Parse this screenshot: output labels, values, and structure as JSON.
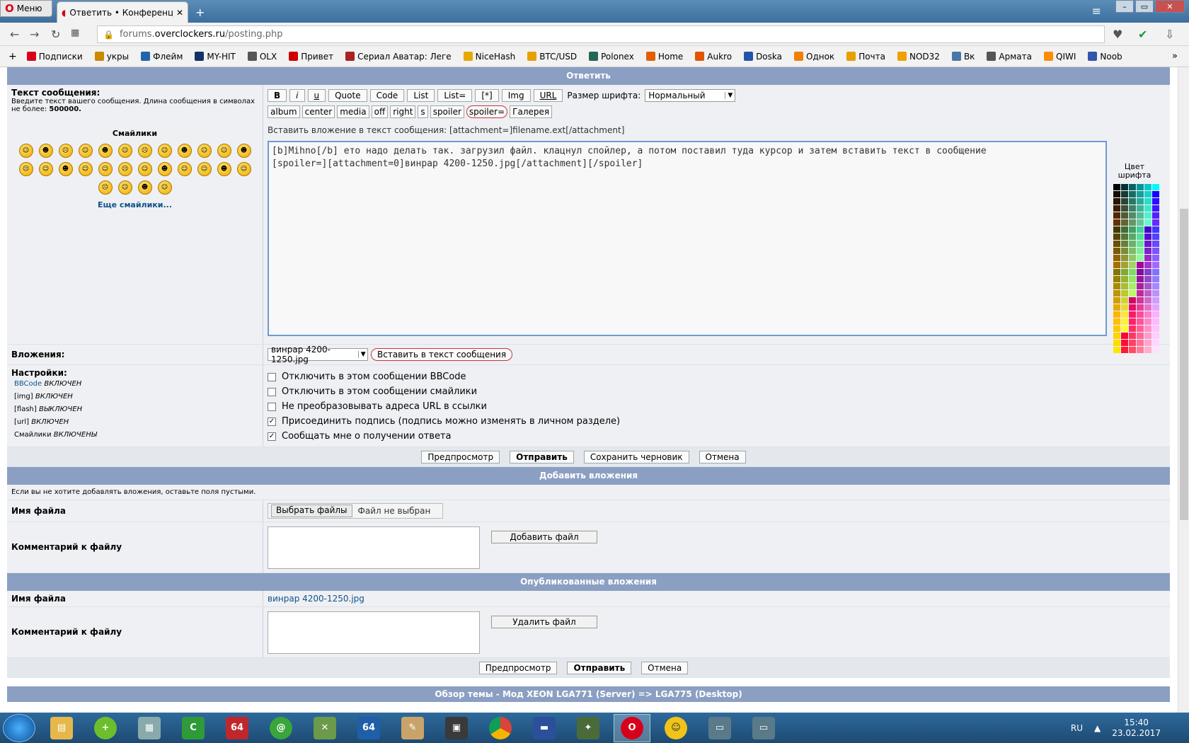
{
  "browser": {
    "menu_label": "Меню",
    "tab_title": "Ответить • Конференция",
    "url_prefix": "forums.",
    "url_domain": "overclockers.ru",
    "url_path": "/posting.php"
  },
  "bookmarks": [
    {
      "label": "Подписки",
      "color": "#d6001c"
    },
    {
      "label": "укры",
      "color": "#cc8800"
    },
    {
      "label": "Флейм",
      "color": "#2266aa"
    },
    {
      "label": "MY-HIT",
      "color": "#113366"
    },
    {
      "label": "OLX",
      "color": "#555555"
    },
    {
      "label": "Привет",
      "color": "#cc0000"
    },
    {
      "label": "Сериал Аватар: Леге",
      "color": "#aa2222"
    },
    {
      "label": "NiceHash",
      "color": "#e6a800"
    },
    {
      "label": "BTC/USD",
      "color": "#e8a000"
    },
    {
      "label": "Polonex",
      "color": "#226655"
    },
    {
      "label": "Home",
      "color": "#e06000"
    },
    {
      "label": "Aukro",
      "color": "#e05500"
    },
    {
      "label": "Doska",
      "color": "#2255aa"
    },
    {
      "label": "Однок",
      "color": "#ee8200"
    },
    {
      "label": "Почта",
      "color": "#e6a000"
    },
    {
      "label": "NOD32",
      "color": "#f0a000"
    },
    {
      "label": "Вк",
      "color": "#4a76a8"
    },
    {
      "label": "Армата",
      "color": "#555555"
    },
    {
      "label": "QIWI",
      "color": "#ff8c00"
    },
    {
      "label": "Noob",
      "color": "#3355aa"
    }
  ],
  "reply": {
    "header": "Ответить",
    "message_label": "Текст сообщения:",
    "message_hint": "Введите текст вашего сообщения. Длина сообщения в символах не более:",
    "message_limit": "500000.",
    "smilies_title": "Смайлики",
    "more_smilies": "Еще смайлики...",
    "toolbar_row1": [
      "B",
      "i",
      "u",
      "Quote",
      "Code",
      "List",
      "List=",
      "[*]",
      "Img",
      "URL"
    ],
    "font_size_label": "Размер шрифта:",
    "font_size_value": "Нормальный",
    "toolbar_row2": [
      "album",
      "center",
      "media",
      "off",
      "right",
      "s",
      "spoiler",
      "spoiler=",
      "Галерея"
    ],
    "insert_hint": "Вставить вложение в текст сообщения: [attachment=]filename.ext[/attachment]",
    "text_line1": "[b]Mihno[/b] ето надо делать так. загрузил файл. клацнул спойлер, а потом поставил туда курсор и затем вставить текст в сообщение",
    "text_line2": "[spoiler=][attachment=0]винрар 4200-1250.jpg[/attachment][/spoiler]",
    "color_title": "Цвет шрифта",
    "attachments_label": "Вложения:",
    "attachment_select": "винрар 4200-1250.jpg",
    "insert_button": "Вставить в текст сообщения",
    "settings_label": "Настройки:",
    "settings": [
      {
        "name": "BBCode",
        "state": "ВКЛЮЧЕН"
      },
      {
        "name": "[img]",
        "state": "ВКЛЮЧЕН"
      },
      {
        "name": "[flash]",
        "state": "ВЫКЛЮЧЕН"
      },
      {
        "name": "[url]",
        "state": "ВКЛЮЧЕН"
      },
      {
        "name": "Смайлики",
        "state": "ВКЛЮЧЕНЫ"
      }
    ],
    "options": [
      {
        "label": "Отключить в этом сообщении BBCode",
        "checked": false
      },
      {
        "label": "Отключить в этом сообщении смайлики",
        "checked": false
      },
      {
        "label": "Не преобразовывать адреса URL в ссылки",
        "checked": false
      },
      {
        "label": "Присоединить подпись (подпись можно изменять в личном разделе)",
        "checked": true
      },
      {
        "label": "Сообщать мне о получении ответа",
        "checked": true
      }
    ],
    "actions": [
      "Предпросмотр",
      "Отправить",
      "Сохранить черновик",
      "Отмена"
    ]
  },
  "add_attachments": {
    "header": "Добавить вложения",
    "hint": "Если вы не хотите добавлять вложения, оставьте поля пустыми.",
    "file_label": "Имя файла",
    "choose_button": "Выбрать файлы",
    "no_file": "Файл не выбран",
    "comment_label": "Комментарий к файлу",
    "add_button": "Добавить файл"
  },
  "published": {
    "header": "Опубликованные вложения",
    "file_label": "Имя файла",
    "file_name": "винрар 4200-1250.jpg",
    "comment_label": "Комментарий к файлу",
    "delete_button": "Удалить файл",
    "actions": [
      "Предпросмотр",
      "Отправить",
      "Отмена"
    ]
  },
  "topic_review": "Обзор темы - Мод XEON LGA771 (Server) => LGA775 (Desktop)",
  "taskbar": {
    "lang": "RU",
    "time": "15:40",
    "date": "23.02.2017"
  }
}
